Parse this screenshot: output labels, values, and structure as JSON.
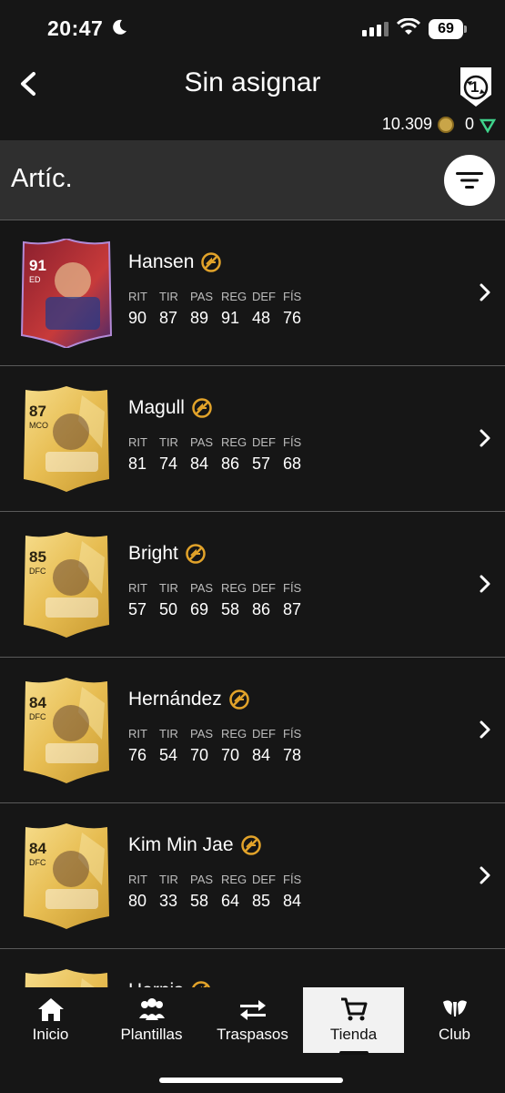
{
  "status": {
    "time": "20:47",
    "battery": "69"
  },
  "header": {
    "title": "Sin asignar",
    "back_icon": "chevron-left-icon",
    "objectives_badge": "1"
  },
  "currency": {
    "coins": "10.309",
    "points": "0"
  },
  "section": {
    "label": "Artíc.",
    "filter_icon": "filter-icon"
  },
  "stat_labels": [
    "RIT",
    "TIR",
    "PAS",
    "REG",
    "DEF",
    "FÍS"
  ],
  "players": [
    {
      "name": "Hansen",
      "rating": "91",
      "position": "ED",
      "card": "special",
      "stats": [
        "90",
        "87",
        "89",
        "91",
        "48",
        "76"
      ]
    },
    {
      "name": "Magull",
      "rating": "87",
      "position": "MCO",
      "card": "gold",
      "stats": [
        "81",
        "74",
        "84",
        "86",
        "57",
        "68"
      ]
    },
    {
      "name": "Bright",
      "rating": "85",
      "position": "DFC",
      "card": "gold",
      "stats": [
        "57",
        "50",
        "69",
        "58",
        "86",
        "87"
      ]
    },
    {
      "name": "Hernández",
      "rating": "84",
      "position": "DFC",
      "card": "gold",
      "stats": [
        "76",
        "54",
        "70",
        "70",
        "84",
        "78"
      ]
    },
    {
      "name": "Kim Min Jae",
      "rating": "84",
      "position": "DFC",
      "card": "gold",
      "stats": [
        "80",
        "33",
        "58",
        "64",
        "85",
        "84"
      ]
    },
    {
      "name": "Hernis",
      "rating": "",
      "position": "",
      "card": "gold",
      "stats": [
        "",
        "",
        "",
        "",
        "",
        ""
      ]
    }
  ],
  "tabs": [
    {
      "label": "Inicio",
      "icon": "home-icon"
    },
    {
      "label": "Plantillas",
      "icon": "squads-icon"
    },
    {
      "label": "Traspasos",
      "icon": "transfers-icon"
    },
    {
      "label": "Tienda",
      "icon": "cart-icon",
      "active": true
    },
    {
      "label": "Club",
      "icon": "club-icon"
    }
  ],
  "colors": {
    "background": "#161616",
    "section": "#2f2f2f",
    "gold": "#e8c25a",
    "untradeable": "#e2a32a"
  }
}
